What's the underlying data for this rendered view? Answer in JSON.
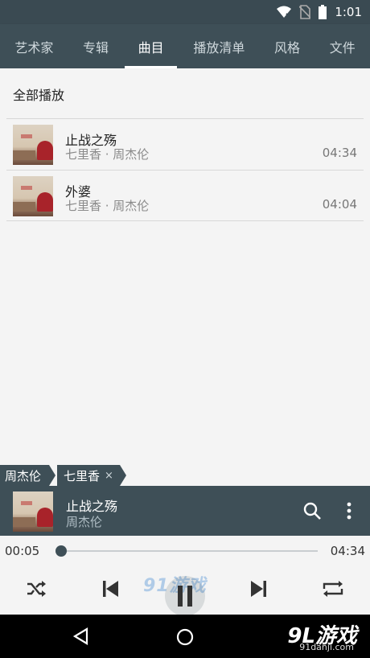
{
  "status_bar": {
    "time": "1:01"
  },
  "tabs": [
    {
      "label": "艺术家",
      "active": false
    },
    {
      "label": "专辑",
      "active": false
    },
    {
      "label": "曲目",
      "active": true
    },
    {
      "label": "播放清单",
      "active": false
    },
    {
      "label": "风格",
      "active": false
    },
    {
      "label": "文件",
      "active": false
    }
  ],
  "content": {
    "play_all": "全部播放",
    "songs": [
      {
        "title": "止战之殇",
        "subtitle": "七里香 · 周杰伦",
        "duration": "04:34"
      },
      {
        "title": "外婆",
        "subtitle": "七里香 · 周杰伦",
        "duration": "04:04"
      }
    ]
  },
  "breadcrumb": {
    "artist": "周杰伦",
    "album": "七里香",
    "close": "×"
  },
  "now_playing": {
    "title": "止战之殇",
    "artist": "周杰伦"
  },
  "player": {
    "current_time": "00:05",
    "total_time": "04:34",
    "progress": 0.018
  },
  "watermark": {
    "overlay": "91游戏",
    "nav_logo": "9L游戏",
    "nav_site": "91danji.com"
  },
  "colors": {
    "primary": "#3e4f57",
    "accent": "#ffffff",
    "background": "#f4f4f4"
  },
  "icons": {
    "status": [
      "wifi-icon",
      "no-sim-icon",
      "battery-icon"
    ],
    "controls": [
      "shuffle-icon",
      "skip-previous-icon",
      "pause-icon",
      "skip-next-icon",
      "repeat-icon"
    ],
    "nav": [
      "back-icon",
      "home-icon"
    ]
  }
}
